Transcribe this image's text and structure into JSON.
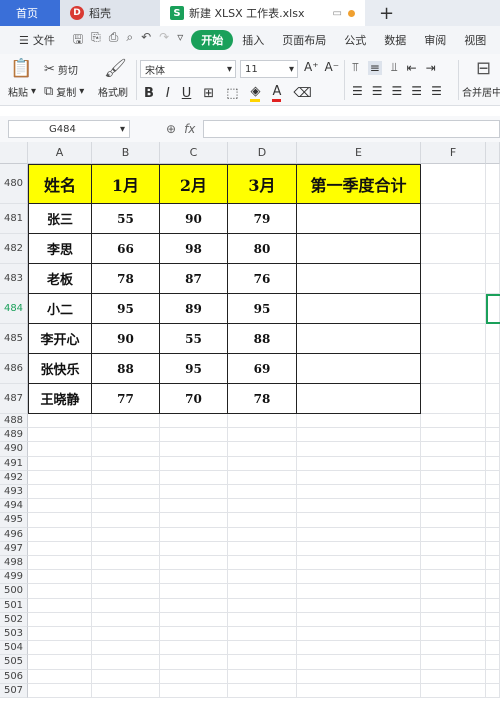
{
  "tabs": {
    "home": "首页",
    "docer": "稻壳",
    "file": "新建 XLSX 工作表.xlsx",
    "plus": "+"
  },
  "menu": {
    "file": "文件",
    "items": [
      "开始",
      "插入",
      "页面布局",
      "公式",
      "数据",
      "审阅",
      "视图"
    ]
  },
  "ribbon": {
    "paste": "粘贴",
    "cut": "剪切",
    "copy": "复制",
    "format_painter": "格式刷",
    "font": "宋体",
    "size": "11",
    "merge": "合并居中"
  },
  "formula": {
    "namebox": "G484",
    "fx": "fx",
    "value": ""
  },
  "grid": {
    "columns": [
      "A",
      "B",
      "C",
      "D",
      "E",
      "F"
    ],
    "rows": [
      "480",
      "481",
      "482",
      "483",
      "484",
      "485",
      "486",
      "487",
      "488",
      "489",
      "490",
      "491",
      "492",
      "493",
      "494",
      "495",
      "496",
      "497",
      "498",
      "499",
      "500",
      "501",
      "502",
      "503",
      "504",
      "505",
      "506",
      "507"
    ],
    "selected_row": "484",
    "table": {
      "headers": [
        "姓名",
        "1月",
        "2月",
        "3月",
        "第一季度合计"
      ],
      "rows": [
        [
          "张三",
          "55",
          "90",
          "79",
          ""
        ],
        [
          "李思",
          "66",
          "98",
          "80",
          ""
        ],
        [
          "老板",
          "78",
          "87",
          "76",
          ""
        ],
        [
          "小二",
          "95",
          "89",
          "95",
          ""
        ],
        [
          "李开心",
          "90",
          "55",
          "88",
          ""
        ],
        [
          "张快乐",
          "88",
          "95",
          "69",
          ""
        ],
        [
          "王晓静",
          "77",
          "70",
          "78",
          ""
        ]
      ]
    }
  }
}
